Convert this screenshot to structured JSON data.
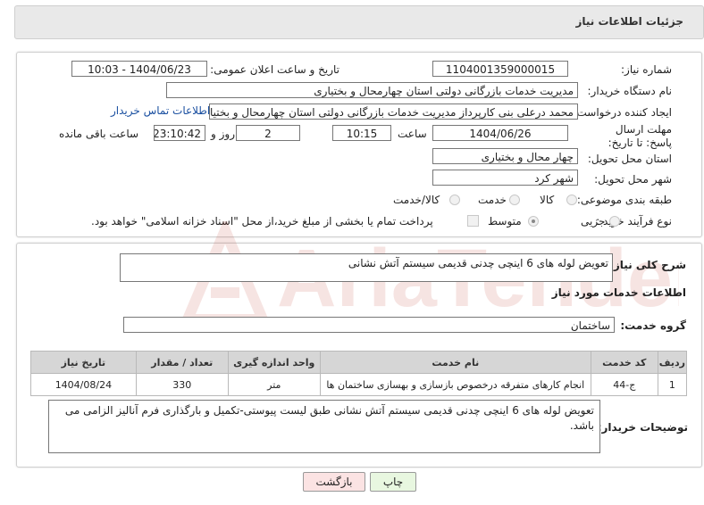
{
  "header": {
    "title": "جزئیات اطلاعات نیاز"
  },
  "form": {
    "need_number_label": "شماره نیاز:",
    "need_number": "1104001359000015",
    "announce_label": "تاریخ و ساعت اعلان عمومی:",
    "announce_value": "1404/06/23 - 10:03",
    "buyer_org_label": "نام دستگاه خریدار:",
    "buyer_org": "مدیریت خدمات بازرگانی دولتی استان چهارمحال و بختیاری",
    "creator_label": "ایجاد کننده درخواست:",
    "creator": "محمد درعلی بنی کارپرداز مدیریت خدمات بازرگانی دولتی استان چهارمحال و بختیاری",
    "contact_link": "اطلاعات تماس خریدار",
    "deadline_label": "مهلت ارسال پاسخ: تا تاریخ:",
    "deadline_date": "1404/06/26",
    "time_label": "ساعت",
    "deadline_time": "10:15",
    "days_value": "2",
    "days_label": "روز و",
    "remaining_time": "23:10:42",
    "remaining_label": "ساعت باقی مانده",
    "province_label": "استان محل تحویل:",
    "province": "چهار محال و بختیاری",
    "city_label": "شهر محل تحویل:",
    "city": "شهر کرد",
    "category_label": "طبقه بندی موضوعی:",
    "category_options": [
      "کالا",
      "خدمت",
      "کالا/خدمت"
    ],
    "category_selected": "خدمت",
    "process_label": "نوع فرآیند خرید :",
    "process_options": [
      "جزیی",
      "متوسط"
    ],
    "process_selected": "متوسط",
    "payment_note": "پرداخت تمام یا بخشی از مبلغ خرید،از محل \"اسناد خزانه اسلامی\" خواهد بود."
  },
  "summary": {
    "label": "شرح کلی نیاز:",
    "value": "تعویض لوله های 6 اینچی چدنی قدیمی سیستم آتش نشانی"
  },
  "services": {
    "section_title": "اطلاعات خدمات مورد نیاز",
    "group_label": "گروه خدمت:",
    "group_value": "ساختمان",
    "columns": [
      "ردیف",
      "کد خدمت",
      "نام خدمت",
      "واحد اندازه گیری",
      "تعداد / مقدار",
      "تاریخ نیاز"
    ],
    "rows": [
      [
        "1",
        "ج-44",
        "انجام کارهای متفرقه درخصوص بازسازی و بهسازی ساختمان ها",
        "متر",
        "330",
        "1404/08/24"
      ]
    ]
  },
  "buyer_notes": {
    "label": "توضیحات خریدار:",
    "value": "تعویض لوله های 6 اینچی چدنی قدیمی سیستم آتش نشانی طبق لیست پیوستی-تکمیل و بارگذاری فرم آنالیز الزامی می باشد."
  },
  "buttons": {
    "print": "چاپ",
    "back": "بازگشت"
  },
  "watermark": "AriaTender.net",
  "colors": {
    "link": "#1a4fa0",
    "print_bg": "#e8f7e0",
    "back_bg": "#fbe3e3"
  }
}
